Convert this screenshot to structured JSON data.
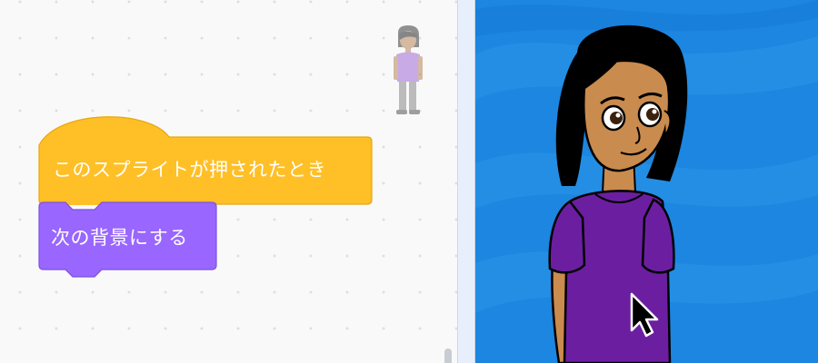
{
  "code_area": {
    "hat_block": {
      "label": "このスプライトが押されたとき",
      "category": "events",
      "color": "#ffbf26"
    },
    "looks_block": {
      "label": "次の背景にする",
      "category": "looks",
      "color": "#9966ff"
    },
    "sprite_watermark_icon": "sprite-thumbnail-icon"
  },
  "stage": {
    "backdrop": "blue-waves-backdrop",
    "sprite": "girl-purple-shirt-sprite",
    "cursor_icon": "mouse-pointer-icon",
    "colors": {
      "backdrop": "#1c86e0",
      "shirt": "#6b1fa0",
      "skin": "#c98b4e",
      "hair": "#000000"
    }
  }
}
